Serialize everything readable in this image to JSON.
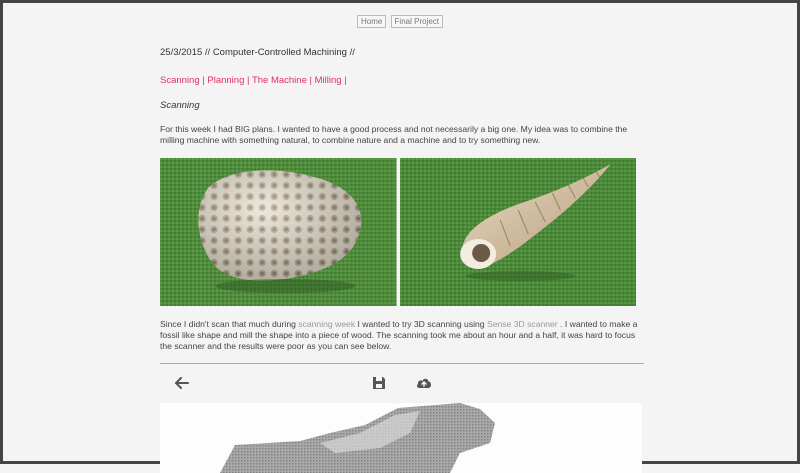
{
  "nav": {
    "home": "Home",
    "final_project": "Final Project"
  },
  "post": {
    "date_title": "25/3/2015 // Computer-Controlled Machining //",
    "sections": [
      "Scanning",
      "Planning",
      "The Machine",
      "Milling"
    ],
    "subheading": "Scanning",
    "paragraph1": "For this week I had BIG plans. I wanted to have a good process and not necessarily a big one. My idea was to combine the milling machine with something natural, to combine nature and a machine and to try something new.",
    "paragraph2": {
      "part1": "Since I didn't scan that much during ",
      "link1": "scanning week",
      "part2": " I wanted to try 3D scanning using ",
      "link2": "Sense 3D scanner",
      "part3": " . I wanted to make a fossil like shape and mill the shape into a piece of wood. The scanning took me about an hour and a half, it was hard to focus the scanner and the results were poor as you can see below."
    }
  },
  "colors": {
    "accent": "#e2305e",
    "link_muted": "#999999",
    "photo_bg": "#4e8a3c"
  },
  "icons": {
    "back": "arrow-left-icon",
    "save": "floppy-disk-icon",
    "upload": "cloud-upload-icon"
  }
}
